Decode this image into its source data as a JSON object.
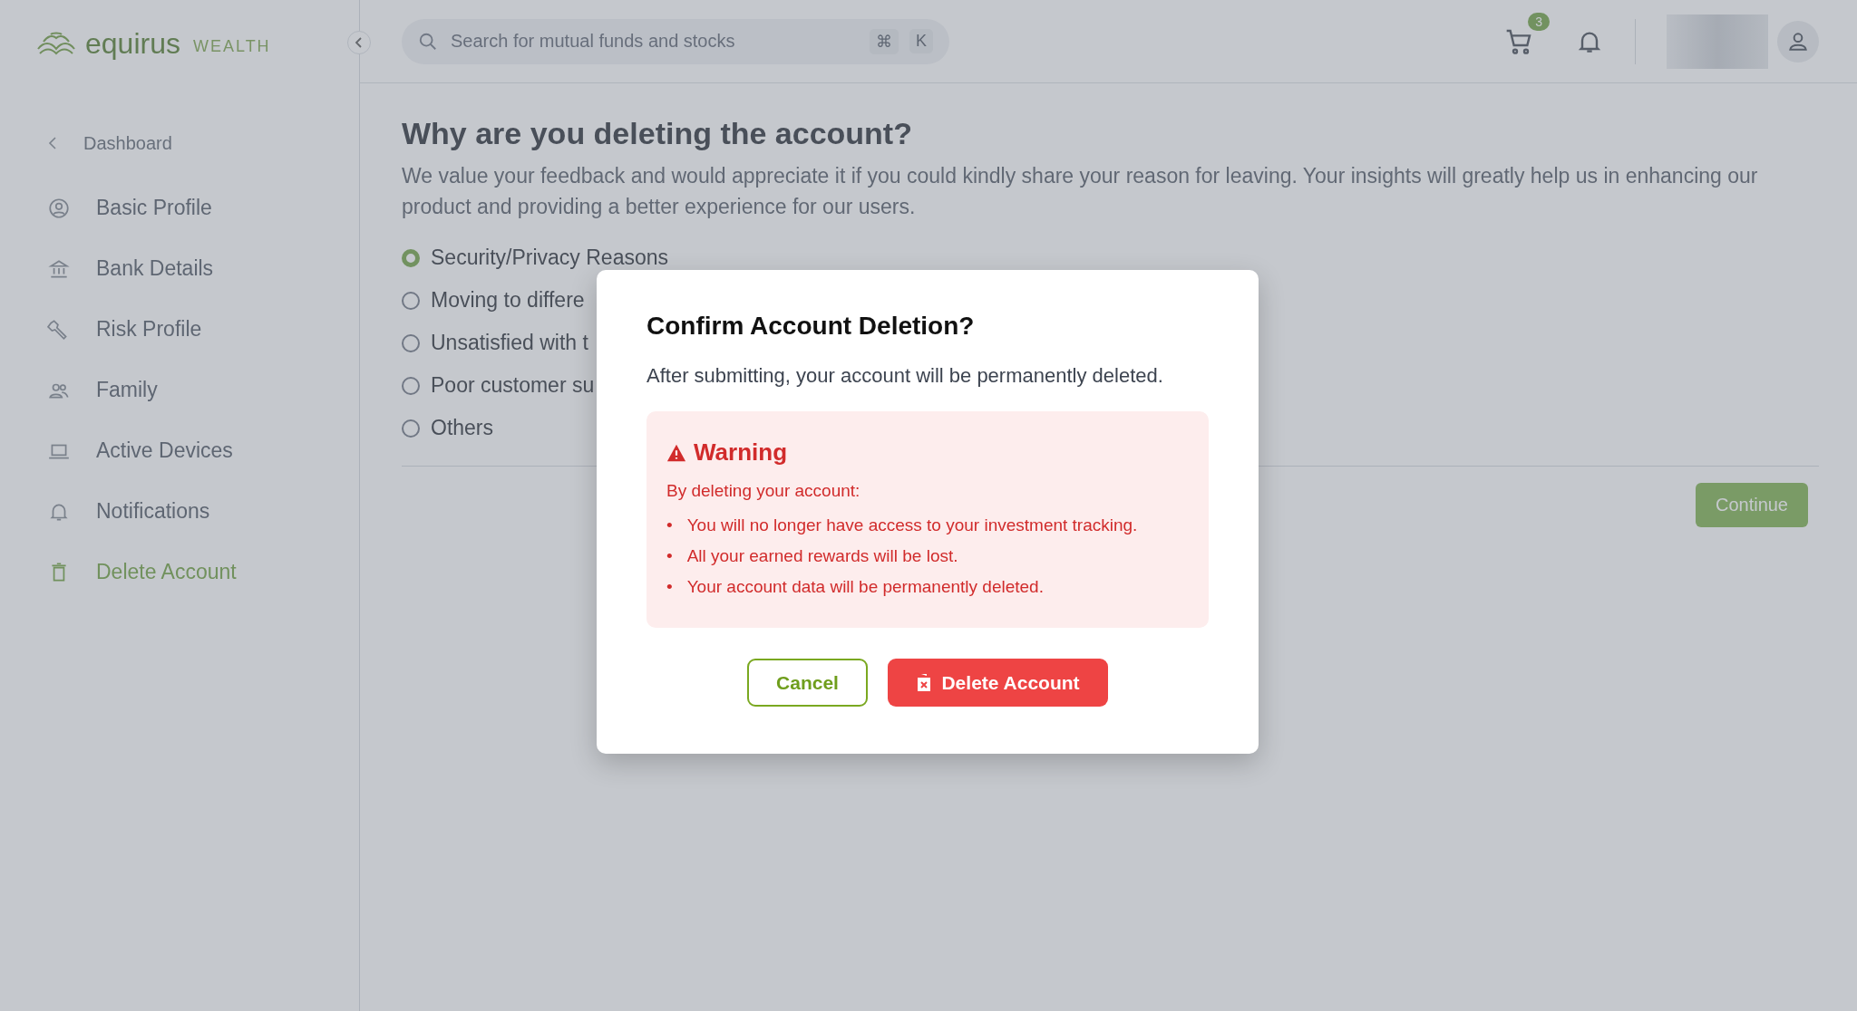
{
  "brand": {
    "name": "equirus",
    "tagline": "WEALTH"
  },
  "sidebar": {
    "back": "Dashboard",
    "items": [
      {
        "label": "Basic Profile",
        "selected": false
      },
      {
        "label": "Bank Details",
        "selected": false
      },
      {
        "label": "Risk Profile",
        "selected": false
      },
      {
        "label": "Family",
        "selected": false
      },
      {
        "label": "Active Devices",
        "selected": false
      },
      {
        "label": "Notifications",
        "selected": false
      },
      {
        "label": "Delete Account",
        "selected": true
      }
    ]
  },
  "search": {
    "placeholder": "Search for mutual funds and stocks",
    "keys": [
      "⌘",
      "K"
    ]
  },
  "cart": {
    "count": "3"
  },
  "page": {
    "title": "Why are you deleting the account?",
    "description": "We value your feedback and would appreciate it if you could kindly share your reason for leaving. Your insights will greatly help us in enhancing our product and providing a better experience for our users.",
    "reasons": [
      {
        "label": "Security/Privacy Reasons",
        "selected": true
      },
      {
        "label": "Moving to differe",
        "selected": false
      },
      {
        "label": "Unsatisfied with t",
        "selected": false
      },
      {
        "label": "Poor customer su",
        "selected": false
      },
      {
        "label": "Others",
        "selected": false
      }
    ],
    "continue": "Continue"
  },
  "dialog": {
    "title": "Confirm Account Deletion?",
    "message": "After submitting, your account will be permanently deleted.",
    "warning": {
      "title": "Warning",
      "intro": "By deleting your account:",
      "bullet": "•",
      "points": [
        "You will no longer have access to your investment tracking.",
        "All your earned rewards will be lost.",
        "Your account data will be permanently deleted."
      ]
    },
    "cancel": "Cancel",
    "confirm": "Delete Account"
  }
}
